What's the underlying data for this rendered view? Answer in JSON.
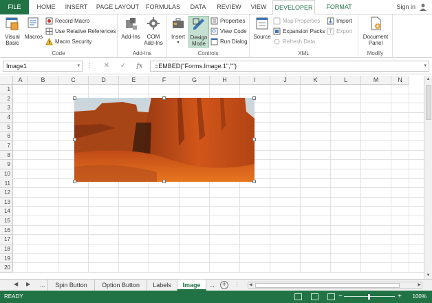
{
  "ribbon_tabs": {
    "file": "FILE",
    "home": "HOME",
    "insert": "INSERT",
    "page_layout": "PAGE LAYOUT",
    "formulas": "FORMULAS",
    "data": "DATA",
    "review": "REVIEW",
    "view": "VIEW",
    "developer": "DEVELOPER",
    "format": "FORMAT",
    "sign_in": "Sign in"
  },
  "code_group": {
    "label": "Code",
    "visual_basic": "Visual\nBasic",
    "macros": "Macros",
    "record_macro": "Record Macro",
    "use_relative": "Use Relative References",
    "macro_security": "Macro Security"
  },
  "addins_group": {
    "label": "Add-Ins",
    "addins": "Add-Ins",
    "com_addins": "COM\nAdd-Ins"
  },
  "controls_group": {
    "label": "Controls",
    "insert": "Insert",
    "design_mode": "Design\nMode",
    "properties": "Properties",
    "view_code": "View Code",
    "run_dialog": "Run Dialog"
  },
  "xml_group": {
    "label": "XML",
    "source": "Source",
    "map_properties": "Map Properties",
    "expansion_packs": "Expansion Packs",
    "refresh_data": "Refresh Data",
    "import": "Import",
    "export": "Export"
  },
  "modify_group": {
    "label": "Modify",
    "document_panel": "Document\nPanel"
  },
  "formula_bar": {
    "name_box": "Image1",
    "fx": "fx",
    "formula": "=EMBED(\"Forms.Image.1\",\"\")"
  },
  "columns": [
    "A",
    "B",
    "C",
    "D",
    "E",
    "F",
    "G",
    "H",
    "I",
    "J",
    "K",
    "L",
    "M",
    "N"
  ],
  "rows": [
    "1",
    "2",
    "3",
    "4",
    "5",
    "6",
    "7",
    "8",
    "9",
    "10",
    "11",
    "12",
    "13",
    "14",
    "15",
    "16",
    "17",
    "18",
    "19",
    "20"
  ],
  "sheet_tabs": {
    "ellipsis_left": "...",
    "spin_button": "Spin Button",
    "option_button": "Option Button",
    "labels": "Labels",
    "image": "Image",
    "ellipsis_right": "..."
  },
  "status_bar": {
    "ready": "READY",
    "zoom": "100%"
  },
  "colors": {
    "excel_green": "#217346",
    "pressed_bg": "#c5e0d0"
  }
}
